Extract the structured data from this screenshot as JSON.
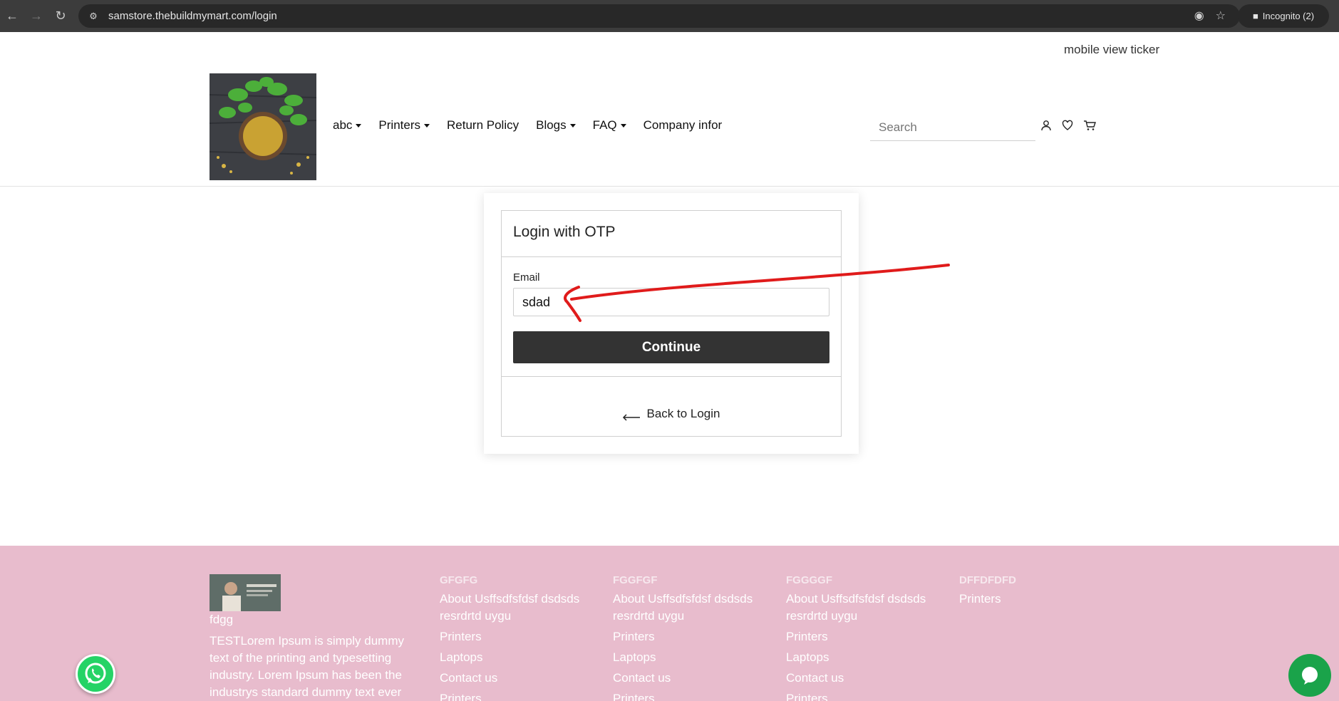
{
  "browser": {
    "url": "samstore.thebuildmymart.com/login",
    "incognito_label": "Incognito (2)"
  },
  "header": {
    "ticker": "mobile view ticker",
    "nav": [
      {
        "label": "abc",
        "dropdown": true
      },
      {
        "label": "Printers",
        "dropdown": true
      },
      {
        "label": "Return Policy",
        "dropdown": false
      },
      {
        "label": "Blogs",
        "dropdown": true
      },
      {
        "label": "FAQ",
        "dropdown": true
      },
      {
        "label": "Company infor",
        "dropdown": false
      }
    ],
    "search_placeholder": "Search"
  },
  "login": {
    "title": "Login with OTP",
    "email_label": "Email",
    "email_value": "sdad",
    "continue_label": "Continue",
    "back_label": "Back to Login"
  },
  "footer": {
    "brand": "fdgg",
    "about": "TESTLorem Ipsum is simply dummy text of the printing and typesetting industry. Lorem Ipsum has been the industrys standard dummy text ever",
    "columns": [
      {
        "heading": "GFGFG",
        "links": [
          "About Usffsdfsfdsf dsdsds resrdrtd uygu",
          "Printers",
          "Laptops",
          "Contact us",
          "Printers"
        ]
      },
      {
        "heading": "FGGFGF",
        "links": [
          "About Usffsdfsfdsf dsdsds resrdrtd uygu",
          "Printers",
          "Laptops",
          "Contact us",
          "Printers"
        ]
      },
      {
        "heading": "FGGGGF",
        "links": [
          "About Usffsdfsfdsf dsdsds resrdrtd uygu",
          "Printers",
          "Laptops",
          "Contact us",
          "Printers"
        ]
      },
      {
        "heading": "DFFDFDFD",
        "links": [
          "Printers"
        ]
      }
    ]
  },
  "colors": {
    "footer_bg": "#e8bccd",
    "button_bg": "#333333",
    "annotation": "#e01b1b",
    "whatsapp": "#25d366"
  }
}
